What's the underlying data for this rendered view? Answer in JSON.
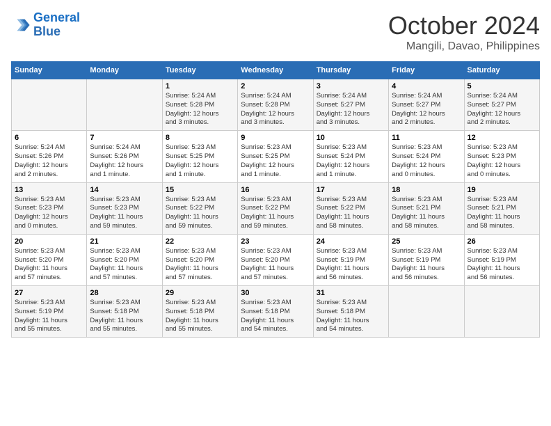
{
  "header": {
    "logo_line1": "General",
    "logo_line2": "Blue",
    "month": "October 2024",
    "location": "Mangili, Davao, Philippines"
  },
  "days_of_week": [
    "Sunday",
    "Monday",
    "Tuesday",
    "Wednesday",
    "Thursday",
    "Friday",
    "Saturday"
  ],
  "weeks": [
    [
      {
        "day": "",
        "info": ""
      },
      {
        "day": "",
        "info": ""
      },
      {
        "day": "1",
        "info": "Sunrise: 5:24 AM\nSunset: 5:28 PM\nDaylight: 12 hours\nand 3 minutes."
      },
      {
        "day": "2",
        "info": "Sunrise: 5:24 AM\nSunset: 5:28 PM\nDaylight: 12 hours\nand 3 minutes."
      },
      {
        "day": "3",
        "info": "Sunrise: 5:24 AM\nSunset: 5:27 PM\nDaylight: 12 hours\nand 3 minutes."
      },
      {
        "day": "4",
        "info": "Sunrise: 5:24 AM\nSunset: 5:27 PM\nDaylight: 12 hours\nand 2 minutes."
      },
      {
        "day": "5",
        "info": "Sunrise: 5:24 AM\nSunset: 5:27 PM\nDaylight: 12 hours\nand 2 minutes."
      }
    ],
    [
      {
        "day": "6",
        "info": "Sunrise: 5:24 AM\nSunset: 5:26 PM\nDaylight: 12 hours\nand 2 minutes."
      },
      {
        "day": "7",
        "info": "Sunrise: 5:24 AM\nSunset: 5:26 PM\nDaylight: 12 hours\nand 1 minute."
      },
      {
        "day": "8",
        "info": "Sunrise: 5:23 AM\nSunset: 5:25 PM\nDaylight: 12 hours\nand 1 minute."
      },
      {
        "day": "9",
        "info": "Sunrise: 5:23 AM\nSunset: 5:25 PM\nDaylight: 12 hours\nand 1 minute."
      },
      {
        "day": "10",
        "info": "Sunrise: 5:23 AM\nSunset: 5:24 PM\nDaylight: 12 hours\nand 1 minute."
      },
      {
        "day": "11",
        "info": "Sunrise: 5:23 AM\nSunset: 5:24 PM\nDaylight: 12 hours\nand 0 minutes."
      },
      {
        "day": "12",
        "info": "Sunrise: 5:23 AM\nSunset: 5:23 PM\nDaylight: 12 hours\nand 0 minutes."
      }
    ],
    [
      {
        "day": "13",
        "info": "Sunrise: 5:23 AM\nSunset: 5:23 PM\nDaylight: 12 hours\nand 0 minutes."
      },
      {
        "day": "14",
        "info": "Sunrise: 5:23 AM\nSunset: 5:23 PM\nDaylight: 11 hours\nand 59 minutes."
      },
      {
        "day": "15",
        "info": "Sunrise: 5:23 AM\nSunset: 5:22 PM\nDaylight: 11 hours\nand 59 minutes."
      },
      {
        "day": "16",
        "info": "Sunrise: 5:23 AM\nSunset: 5:22 PM\nDaylight: 11 hours\nand 59 minutes."
      },
      {
        "day": "17",
        "info": "Sunrise: 5:23 AM\nSunset: 5:22 PM\nDaylight: 11 hours\nand 58 minutes."
      },
      {
        "day": "18",
        "info": "Sunrise: 5:23 AM\nSunset: 5:21 PM\nDaylight: 11 hours\nand 58 minutes."
      },
      {
        "day": "19",
        "info": "Sunrise: 5:23 AM\nSunset: 5:21 PM\nDaylight: 11 hours\nand 58 minutes."
      }
    ],
    [
      {
        "day": "20",
        "info": "Sunrise: 5:23 AM\nSunset: 5:20 PM\nDaylight: 11 hours\nand 57 minutes."
      },
      {
        "day": "21",
        "info": "Sunrise: 5:23 AM\nSunset: 5:20 PM\nDaylight: 11 hours\nand 57 minutes."
      },
      {
        "day": "22",
        "info": "Sunrise: 5:23 AM\nSunset: 5:20 PM\nDaylight: 11 hours\nand 57 minutes."
      },
      {
        "day": "23",
        "info": "Sunrise: 5:23 AM\nSunset: 5:20 PM\nDaylight: 11 hours\nand 57 minutes."
      },
      {
        "day": "24",
        "info": "Sunrise: 5:23 AM\nSunset: 5:19 PM\nDaylight: 11 hours\nand 56 minutes."
      },
      {
        "day": "25",
        "info": "Sunrise: 5:23 AM\nSunset: 5:19 PM\nDaylight: 11 hours\nand 56 minutes."
      },
      {
        "day": "26",
        "info": "Sunrise: 5:23 AM\nSunset: 5:19 PM\nDaylight: 11 hours\nand 56 minutes."
      }
    ],
    [
      {
        "day": "27",
        "info": "Sunrise: 5:23 AM\nSunset: 5:19 PM\nDaylight: 11 hours\nand 55 minutes."
      },
      {
        "day": "28",
        "info": "Sunrise: 5:23 AM\nSunset: 5:18 PM\nDaylight: 11 hours\nand 55 minutes."
      },
      {
        "day": "29",
        "info": "Sunrise: 5:23 AM\nSunset: 5:18 PM\nDaylight: 11 hours\nand 55 minutes."
      },
      {
        "day": "30",
        "info": "Sunrise: 5:23 AM\nSunset: 5:18 PM\nDaylight: 11 hours\nand 54 minutes."
      },
      {
        "day": "31",
        "info": "Sunrise: 5:23 AM\nSunset: 5:18 PM\nDaylight: 11 hours\nand 54 minutes."
      },
      {
        "day": "",
        "info": ""
      },
      {
        "day": "",
        "info": ""
      }
    ]
  ]
}
